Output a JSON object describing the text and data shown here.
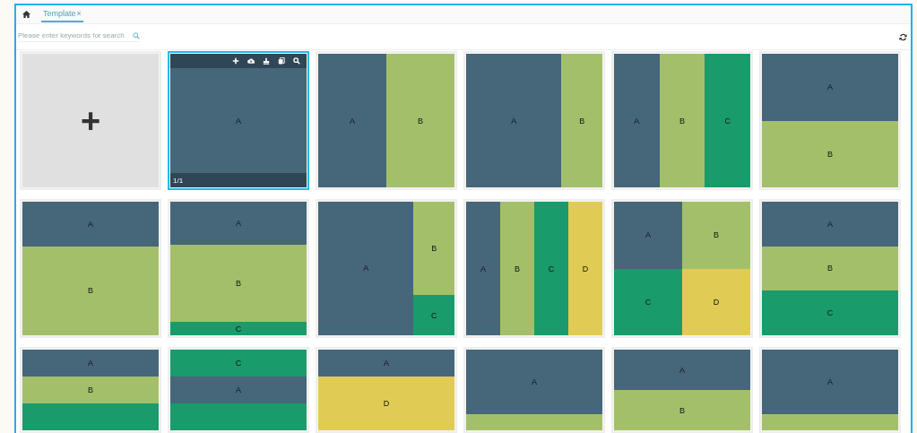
{
  "tabs": [
    {
      "label": "Template",
      "close": "×",
      "selected": true
    }
  ],
  "search": {
    "placeholder": "Please enter keywords for search"
  },
  "tiles": [
    {
      "kind": "add",
      "symbol": "+",
      "selected": false
    },
    {
      "kind": "single",
      "selected": true,
      "page": "1/1",
      "regions": [
        {
          "label": "A",
          "color": "#46667a"
        }
      ]
    },
    {
      "kind": "cols-half",
      "selected": false,
      "regions": [
        {
          "label": "A",
          "color": "#46667a"
        },
        {
          "label": "B",
          "color": "#a3bf6a"
        }
      ]
    },
    {
      "kind": "cols-wide-left",
      "selected": false,
      "regions": [
        {
          "label": "A",
          "color": "#46667a"
        },
        {
          "label": "B",
          "color": "#a3bf6a"
        }
      ]
    },
    {
      "kind": "cols-3",
      "selected": false,
      "regions": [
        {
          "label": "A",
          "color": "#46667a"
        },
        {
          "label": "B",
          "color": "#a3bf6a"
        },
        {
          "label": "C",
          "color": "#1a9b6b"
        }
      ]
    },
    {
      "kind": "rows-half",
      "selected": false,
      "regions": [
        {
          "label": "A",
          "color": "#46667a"
        },
        {
          "label": "B",
          "color": "#a3bf6a"
        }
      ]
    },
    {
      "kind": "rows-short-top",
      "selected": false,
      "regions": [
        {
          "label": "A",
          "color": "#46667a"
        },
        {
          "label": "B",
          "color": "#a3bf6a"
        }
      ]
    },
    {
      "kind": "rows-3-thin-bottom",
      "selected": false,
      "regions": [
        {
          "label": "A",
          "color": "#46667a"
        },
        {
          "label": "B",
          "color": "#a3bf6a"
        },
        {
          "label": "C",
          "color": "#1a9b6b"
        }
      ]
    },
    {
      "kind": "wide-left-split-right",
      "selected": false,
      "regions": [
        {
          "label": "A",
          "color": "#46667a"
        },
        {
          "label": "B",
          "color": "#a3bf6a"
        },
        {
          "label": "C",
          "color": "#1a9b6b"
        }
      ]
    },
    {
      "kind": "cols-4",
      "selected": false,
      "regions": [
        {
          "label": "A",
          "color": "#46667a"
        },
        {
          "label": "B",
          "color": "#a3bf6a"
        },
        {
          "label": "C",
          "color": "#1a9b6b"
        },
        {
          "label": "D",
          "color": "#e0cc55"
        }
      ]
    },
    {
      "kind": "quad",
      "selected": false,
      "regions": [
        {
          "label": "A",
          "color": "#46667a"
        },
        {
          "label": "B",
          "color": "#a3bf6a"
        },
        {
          "label": "C",
          "color": "#1a9b6b"
        },
        {
          "label": "D",
          "color": "#e0cc55"
        }
      ]
    },
    {
      "kind": "rows-3",
      "selected": false,
      "regions": [
        {
          "label": "A",
          "color": "#46667a"
        },
        {
          "label": "B",
          "color": "#a3bf6a"
        },
        {
          "label": "C",
          "color": "#1a9b6b"
        }
      ]
    },
    {
      "kind": "rows-3",
      "selected": false,
      "regions": [
        {
          "label": "A",
          "color": "#46667a"
        },
        {
          "label": "B",
          "color": "#a3bf6a"
        },
        {
          "color": "#1a9b6b"
        }
      ]
    },
    {
      "kind": "rows-3",
      "selected": false,
      "regions": [
        {
          "label": "C",
          "color": "#1a9b6b"
        },
        {
          "label": "A",
          "color": "#46667a"
        },
        {
          "color": "#1a9b6b"
        }
      ]
    },
    {
      "kind": "rows-third-top",
      "selected": false,
      "regions": [
        {
          "label": "A",
          "color": "#46667a"
        },
        {
          "label": "D",
          "color": "#e0cc55"
        }
      ]
    },
    {
      "kind": "rows-three-fifths-top",
      "selected": false,
      "regions": [
        {
          "label": "A",
          "color": "#46667a"
        },
        {
          "color": "#a3bf6a"
        }
      ]
    },
    {
      "kind": "rows-half",
      "selected": false,
      "regions": [
        {
          "label": "A",
          "color": "#46667a"
        },
        {
          "label": "B",
          "color": "#a3bf6a"
        }
      ]
    },
    {
      "kind": "rows-three-fifths-top",
      "selected": false,
      "regions": [
        {
          "label": "A",
          "color": "#46667a"
        },
        {
          "color": "#a3bf6a"
        }
      ]
    }
  ]
}
